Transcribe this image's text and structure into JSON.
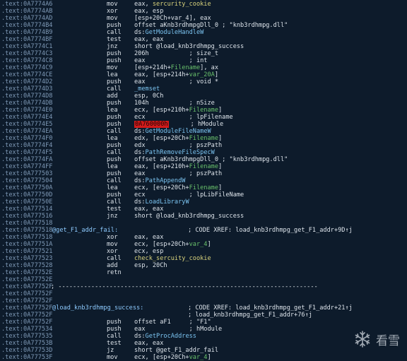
{
  "watermark": {
    "text": "看雪",
    "icon": "snowflake-icon"
  },
  "lines": [
    {
      "addr": ".text:0A7774A6",
      "mn": "mov",
      "op": "eax, ",
      "op2": "sercurity_cookie",
      "op2c": "y"
    },
    {
      "addr": ".text:0A7774AB",
      "mn": "xor",
      "op": "eax, esp"
    },
    {
      "addr": ".text:0A7774AD",
      "mn": "mov",
      "op": "[esp+20Ch+var_4], eax"
    },
    {
      "addr": ".text:0A7774B4",
      "mn": "push",
      "op": "offset aKnb3rdhmpgDll_0 ; \"knb3rdhmpg.dll\""
    },
    {
      "addr": ".text:0A7774B9",
      "mn": "call",
      "op": "ds:",
      "op2": "GetModuleHandleW",
      "op2c": "c"
    },
    {
      "addr": ".text:0A7774BF",
      "mn": "test",
      "op": "eax, eax"
    },
    {
      "addr": ".text:0A7774C1",
      "mn": "jnz",
      "op": "short @load_knb3rdhmpg_success"
    },
    {
      "addr": ".text:0A7774C3",
      "mn": "push",
      "op": "206h           ; size_t"
    },
    {
      "addr": ".text:0A7774C8",
      "mn": "push",
      "op": "eax            ; int"
    },
    {
      "addr": ".text:0A7774C9",
      "mn": "mov",
      "op": "[esp+214h+",
      "op2": "Filename",
      "op2c": "g",
      "op3": "], ax"
    },
    {
      "addr": ".text:0A7774CE",
      "mn": "lea",
      "op": "eax, [esp+214h+",
      "op2": "var_20A",
      "op2c": "g",
      "op3": "]"
    },
    {
      "addr": ".text:0A7774D2",
      "mn": "push",
      "op": "eax            ; void *"
    },
    {
      "addr": ".text:0A7774D3",
      "mn": "call",
      "op": "",
      "op2": "_memset",
      "op2c": "c"
    },
    {
      "addr": ".text:0A7774D8",
      "mn": "add",
      "op": "esp, 0Ch"
    },
    {
      "addr": ".text:0A7774DB",
      "mn": "push",
      "op": "104h           ; nSize"
    },
    {
      "addr": ".text:0A7774E0",
      "mn": "lea",
      "op": "ecx, [esp+210h+",
      "op2": "Filename",
      "op2c": "g",
      "op3": "]"
    },
    {
      "addr": ".text:0A7774E4",
      "mn": "push",
      "op": "ecx            ; lpFilename"
    },
    {
      "addr": ".text:0A7774E5",
      "mn": "push",
      "op": "",
      "op2": "0A760000h",
      "op2c": "hl",
      "op3": "      ; hModule"
    },
    {
      "addr": ".text:0A7774EA",
      "mn": "call",
      "op": "ds:",
      "op2": "GetModuleFileNameW",
      "op2c": "c"
    },
    {
      "addr": ".text:0A7774F0",
      "mn": "lea",
      "op": "edx, [esp+20Ch+",
      "op2": "Filename",
      "op2c": "g",
      "op3": "]"
    },
    {
      "addr": ".text:0A7774F4",
      "mn": "push",
      "op": "edx            ; pszPath"
    },
    {
      "addr": ".text:0A7774F5",
      "mn": "call",
      "op": "ds:",
      "op2": "PathRemoveFileSpecW",
      "op2c": "c"
    },
    {
      "addr": ".text:0A7774FA",
      "mn": "push",
      "op": "offset aKnb3rdhmpgDll_0 ; \"knb3rdhmpg.dll\""
    },
    {
      "addr": ".text:0A7774FF",
      "mn": "lea",
      "op": "eax, [esp+210h+",
      "op2": "Filename",
      "op2c": "g",
      "op3": "]"
    },
    {
      "addr": ".text:0A777503",
      "mn": "push",
      "op": "eax            ; pszPath"
    },
    {
      "addr": ".text:0A777504",
      "mn": "call",
      "op": "ds:",
      "op2": "PathAppendW",
      "op2c": "c"
    },
    {
      "addr": ".text:0A77750A",
      "mn": "lea",
      "op": "ecx, [esp+20Ch+",
      "op2": "Filename",
      "op2c": "g",
      "op3": "]"
    },
    {
      "addr": ".text:0A77750D",
      "mn": "push",
      "op": "ecx            ; lpLibFileName"
    },
    {
      "addr": ".text:0A77750E",
      "mn": "call",
      "op": "ds:",
      "op2": "LoadLibraryW",
      "op2c": "c"
    },
    {
      "addr": ".text:0A777514",
      "mn": "test",
      "op": "eax, eax"
    },
    {
      "addr": ".text:0A777516",
      "mn": "jnz",
      "op": "short @load_knb3rdhmpg_success"
    },
    {
      "addr": ".text:0A777518",
      "mn": "",
      "op": ""
    },
    {
      "addr": ".text:0A777518",
      "label": "@get_F1_addr_fail:",
      "xref": "; CODE XREF: load_knb3rdhmpg_get_F1_addr+9D↑j"
    },
    {
      "addr": ".text:0A777518",
      "mn": "xor",
      "op": "eax, eax"
    },
    {
      "addr": ".text:0A77751A",
      "mn": "mov",
      "op": "ecx, [esp+20Ch+",
      "op2": "var_4",
      "op2c": "g",
      "op3": "]"
    },
    {
      "addr": ".text:0A777521",
      "mn": "xor",
      "op": "ecx, esp"
    },
    {
      "addr": ".text:0A777523",
      "mn": "call",
      "op": "",
      "op2": "check_sercuity_cookie",
      "op2c": "y"
    },
    {
      "addr": ".text:0A777528",
      "mn": "add",
      "op": "esp, 20Ch"
    },
    {
      "addr": ".text:0A77752E",
      "mn": "retn",
      "op": ""
    },
    {
      "addr": ".text:0A77752E",
      "mn": "",
      "op": ""
    },
    {
      "addr": ".text:0A77752F",
      "sep": "; -----------------------------------------------------------------------"
    },
    {
      "addr": ".text:0A77752F",
      "mn": "",
      "op": ""
    },
    {
      "addr": ".text:0A77752F",
      "mn": "",
      "op": ""
    },
    {
      "addr": ".text:0A77752F",
      "label": "@load_knb3rdhmpg_success:",
      "xref": "; CODE XREF: load_knb3rdhmpg_get_F1_addr+21↑j"
    },
    {
      "addr": ".text:0A77752F",
      "xref": "; load_knb3rdhmpg_get_F1_addr+76↑j"
    },
    {
      "addr": ".text:0A77752F",
      "mn": "push",
      "op": "offset aF1     ; \"F1\""
    },
    {
      "addr": ".text:0A777534",
      "mn": "push",
      "op": "eax            ; hModule"
    },
    {
      "addr": ".text:0A777535",
      "mn": "call",
      "op": "ds:",
      "op2": "GetProcAddress",
      "op2c": "c"
    },
    {
      "addr": ".text:0A77753B",
      "mn": "test",
      "op": "eax, eax"
    },
    {
      "addr": ".text:0A77753D",
      "mn": "jz",
      "op": "short @get_F1_addr_fail"
    },
    {
      "addr": ".text:0A77753F",
      "mn": "mov",
      "op": "ecx, [esp+20Ch+",
      "op2": "var_4",
      "op2c": "g",
      "op3": "]"
    }
  ]
}
